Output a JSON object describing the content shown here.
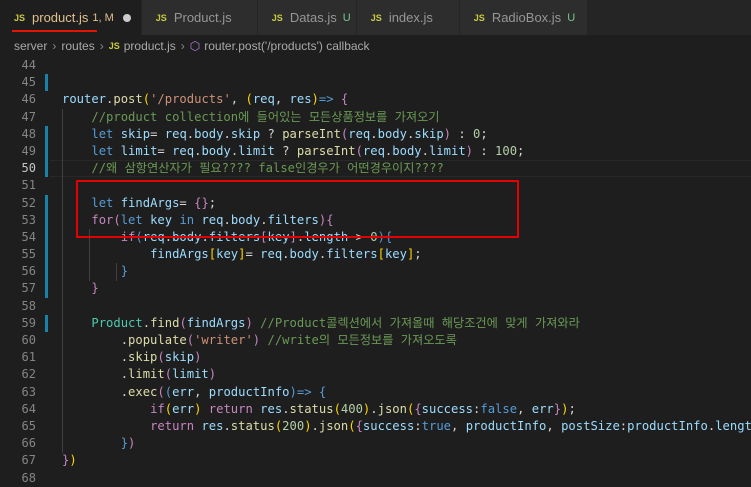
{
  "tabs": [
    {
      "label": "product.js",
      "badge": "1, M",
      "dirty": true,
      "active": true
    },
    {
      "label": "Product.js",
      "badge": "",
      "active": false
    },
    {
      "label": "Datas.js",
      "badge": "U",
      "active": false
    },
    {
      "label": "index.js",
      "badge": "",
      "active": false
    },
    {
      "label": "RadioBox.js",
      "badge": "U",
      "active": false
    }
  ],
  "breadcrumb": {
    "items": [
      "server",
      "routes",
      "product.js",
      "router.post('/products') callback"
    ]
  },
  "file_icon": "JS",
  "line_numbers": [
    "44",
    "45",
    "46",
    "47",
    "48",
    "49",
    "50",
    "51",
    "52",
    "53",
    "54",
    "55",
    "56",
    "57",
    "58",
    "59",
    "60",
    "61",
    "62",
    "63",
    "64",
    "65",
    "66",
    "67",
    "68"
  ],
  "code": {
    "l46": [
      "router",
      "post",
      "'/products'",
      "req",
      "res"
    ],
    "l47": "//product collection에 들어있는 모든상품정보를 가져오기",
    "l48": [
      "let",
      "skip",
      "req",
      "body",
      "skip",
      "parseInt",
      "req",
      "body",
      "skip",
      "0"
    ],
    "l49": [
      "let",
      "limit",
      "req",
      "body",
      "limit",
      "parseInt",
      "req",
      "body",
      "limit",
      "100"
    ],
    "l50": "//왜 삼항연산자가 필요???? false인경우가 어떤경우이지????",
    "l52": [
      "let",
      "findArgs"
    ],
    "l53": [
      "for",
      "let",
      "key",
      "in",
      "req",
      "body",
      "filters"
    ],
    "l54": [
      "if",
      "req",
      "body",
      "filters",
      "key",
      "length",
      "0"
    ],
    "l55": [
      "findArgs",
      "key",
      "req",
      "body",
      "filters",
      "key"
    ],
    "l59": [
      "Product",
      "find",
      "findArgs",
      "//Product콜렉션에서 가져올때 해당조건에 맞게 가져와라"
    ],
    "l60": [
      "populate",
      "'writer'",
      "//write의 모든정보를 가져오도록"
    ],
    "l61": [
      "skip",
      "skip"
    ],
    "l62": [
      "limit",
      "limit"
    ],
    "l63": [
      "exec",
      "err",
      "productInfo"
    ],
    "l64": [
      "if",
      "err",
      "return",
      "res",
      "status",
      "400",
      "json",
      "success",
      "false",
      "err"
    ],
    "l65": [
      "return",
      "res",
      "status",
      "200",
      "json",
      "success",
      "true",
      "productInfo",
      "postSize",
      "productInfo",
      "length"
    ]
  },
  "colors": {
    "background": "#1e1e1e",
    "highlight_box": "#e20000",
    "active_tab_underline": "#e51400"
  }
}
